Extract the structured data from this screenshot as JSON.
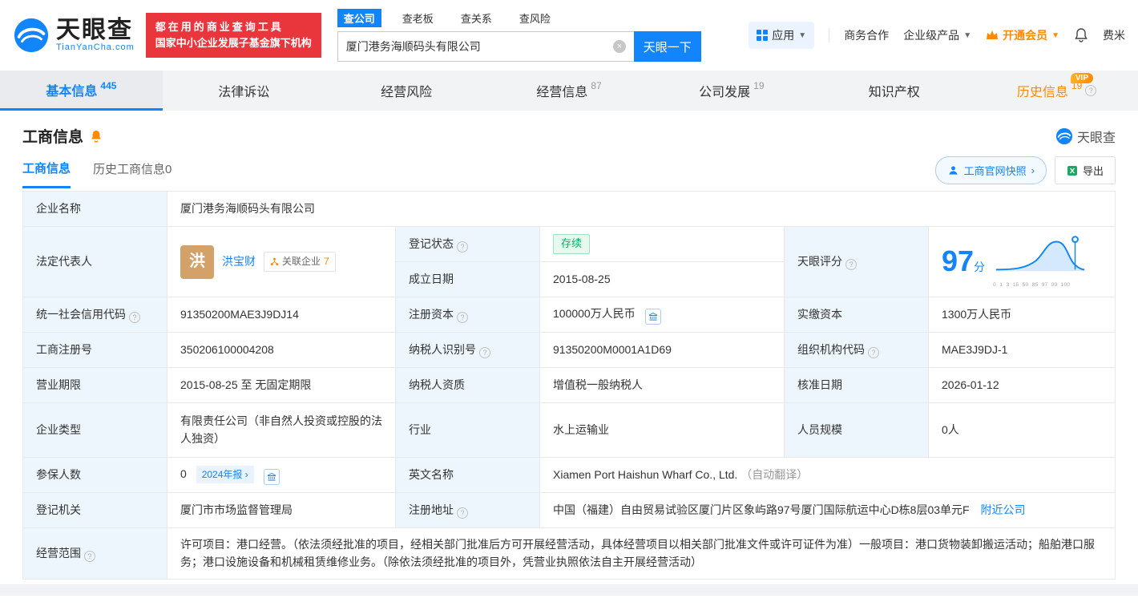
{
  "header": {
    "logo_text": "天眼查",
    "logo_sub": "TianYanCha.com",
    "slogan1": "都在用的商业查询工具",
    "slogan2": "国家中小企业发展子基金旗下机构",
    "search_tabs": [
      {
        "label": "查公司"
      },
      {
        "label": "查老板"
      },
      {
        "label": "查关系"
      },
      {
        "label": "查风险"
      }
    ],
    "search": {
      "value": "厦门港务海顺码头有限公司",
      "button": "天眼一下"
    },
    "menu": {
      "apps": "应用",
      "biz": "商务合作",
      "enterprise": "企业级产品",
      "vip": "开通会员",
      "user": "费米"
    }
  },
  "tabs": [
    {
      "label": "基本信息",
      "count": "445"
    },
    {
      "label": "法律诉讼"
    },
    {
      "label": "经营风险"
    },
    {
      "label": "经营信息",
      "count": "87"
    },
    {
      "label": "公司发展",
      "count": "19"
    },
    {
      "label": "知识产权"
    },
    {
      "label": "历史信息",
      "count": "19",
      "vip": "VIP"
    }
  ],
  "section": {
    "title": "工商信息",
    "watermark": "天眼查",
    "subtabs": [
      {
        "label": "工商信息"
      },
      {
        "label": "历史工商信息0"
      }
    ],
    "snapshot_button": "工商官网快照",
    "export_button": "导出"
  },
  "info": {
    "name": {
      "label": "企业名称",
      "value": "厦门港务海顺码头有限公司"
    },
    "legal": {
      "label": "法定代表人",
      "avatar": "洪",
      "name": "洪宝财",
      "related": "关联企业",
      "related_count": "7"
    },
    "status": {
      "label": "登记状态",
      "value": "存续"
    },
    "established": {
      "label": "成立日期",
      "value": "2015-08-25"
    },
    "score": {
      "label": "天眼评分",
      "value": "97",
      "unit": "分",
      "axis": "0 1 3 15 50 85 97 99 100"
    },
    "credit_code": {
      "label": "统一社会信用代码",
      "value": "91350200MAE3J9DJ14"
    },
    "reg_capital": {
      "label": "注册资本",
      "value": "100000万人民币"
    },
    "paid_capital": {
      "label": "实缴资本",
      "value": "1300万人民币"
    },
    "reg_no": {
      "label": "工商注册号",
      "value": "350206100004208"
    },
    "tax_id": {
      "label": "纳税人识别号",
      "value": "91350200M0001A1D69"
    },
    "org_code": {
      "label": "组织机构代码",
      "value": "MAE3J9DJ-1"
    },
    "term": {
      "label": "营业期限",
      "value": "2015-08-25 至 无固定期限"
    },
    "tax_quality": {
      "label": "纳税人资质",
      "value": "增值税一般纳税人"
    },
    "approval": {
      "label": "核准日期",
      "value": "2026-01-12"
    },
    "type": {
      "label": "企业类型",
      "value": "有限责任公司（非自然人投资或控股的法人独资）"
    },
    "industry": {
      "label": "行业",
      "value": "水上运输业"
    },
    "staff": {
      "label": "人员规模",
      "value": "0人"
    },
    "insured": {
      "label": "参保人数",
      "value": "0",
      "badge": "2024年报"
    },
    "english": {
      "label": "英文名称",
      "value": "Xiamen Port Haishun Wharf Co., Ltd.",
      "note": "（自动翻译）"
    },
    "authority": {
      "label": "登记机关",
      "value": "厦门市市场监督管理局"
    },
    "address": {
      "label": "注册地址",
      "value": "中国（福建）自由贸易试验区厦门片区象屿路97号厦门国际航运中心D栋8层03单元F",
      "nearby": "附近公司"
    },
    "scope": {
      "label": "经营范围",
      "value": "许可项目：港口经营。（依法须经批准的项目，经相关部门批准后方可开展经营活动，具体经营项目以相关部门批准文件或许可证件为准）一般项目：港口货物装卸搬运活动；船舶港口服务；港口设施设备和机械租赁维修业务。（除依法须经批准的项目外，凭营业执照依法自主开展经营活动）"
    }
  }
}
